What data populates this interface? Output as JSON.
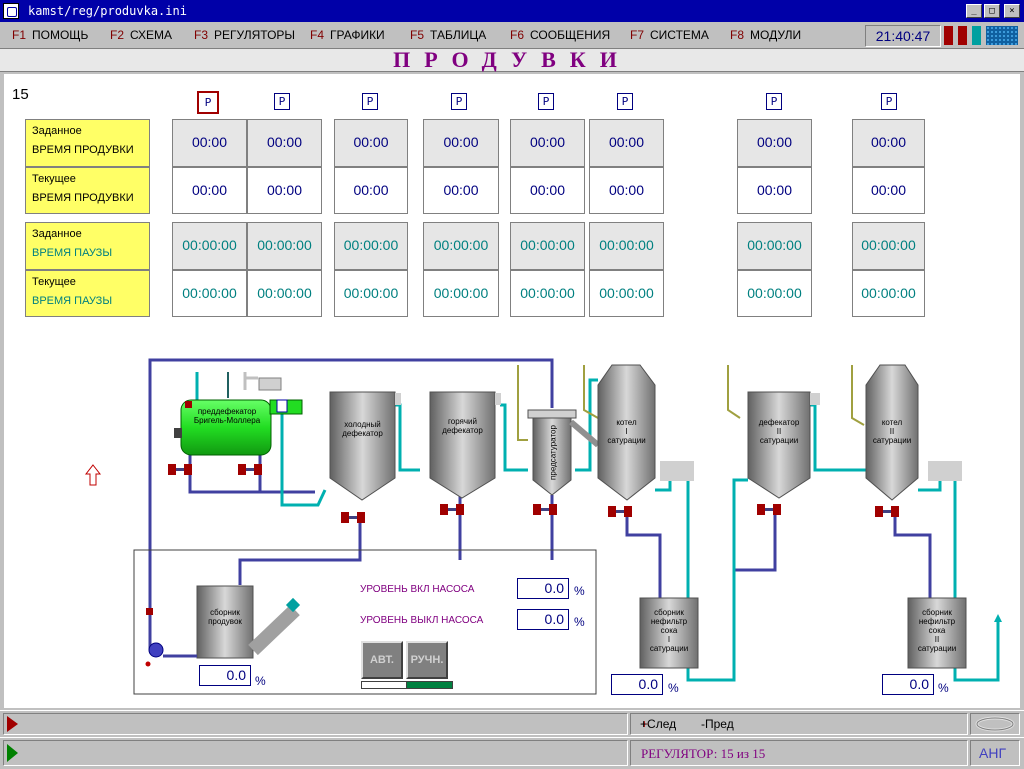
{
  "window": {
    "title": "kamst/reg/produvka.ini"
  },
  "menu": [
    {
      "key": "F1",
      "label": "ПОМОЩЬ"
    },
    {
      "key": "F2",
      "label": "СХЕМА"
    },
    {
      "key": "F3",
      "label": "РЕГУЛЯТОРЫ"
    },
    {
      "key": "F4",
      "label": "ГРАФИКИ"
    },
    {
      "key": "F5",
      "label": "ТАБЛИЦА"
    },
    {
      "key": "F6",
      "label": "СООБЩЕНИЯ"
    },
    {
      "key": "F7",
      "label": "СИСТЕМА"
    },
    {
      "key": "F8",
      "label": "МОДУЛИ"
    }
  ],
  "clock": "21:40:47",
  "header": {
    "title": "ПРОДУВКИ"
  },
  "regulator_number": "15",
  "p_button_label": "P",
  "table": {
    "labels": {
      "set_time_a": "Заданное",
      "set_time_b": "ВРЕМЯ ПРОДУВКИ",
      "cur_time_a": "Текущее",
      "cur_time_b": "ВРЕМЯ ПРОДУВКИ",
      "set_pause_a": "Заданное",
      "set_pause_b": "ВРЕМЯ ПАУЗЫ",
      "cur_pause_a": "Текущее",
      "cur_pause_b": "ВРЕМЯ ПАУЗЫ"
    },
    "blow_set": [
      "00:00",
      "00:00",
      "00:00",
      "00:00",
      "00:00",
      "00:00",
      "00:00",
      "00:00"
    ],
    "blow_cur": [
      "00:00",
      "00:00",
      "00:00",
      "00:00",
      "00:00",
      "00:00",
      "00:00",
      "00:00"
    ],
    "pause_set": [
      "00:00:00",
      "00:00:00",
      "00:00:00",
      "00:00:00",
      "00:00:00",
      "00:00:00",
      "00:00:00",
      "00:00:00"
    ],
    "pause_cur": [
      "00:00:00",
      "00:00:00",
      "00:00:00",
      "00:00:00",
      "00:00:00",
      "00:00:00",
      "00:00:00",
      "00:00:00"
    ]
  },
  "vessels": {
    "predefecator": "преддефекатор\nБригель-Моллера",
    "cold": "холодный\nдефекатор",
    "hot": "горячий\nдефекатор",
    "presaturator": "предсатуратор",
    "boiler1": "котел\nI\nсатурации",
    "defecator2": "дефекатор\nII\nсатурации",
    "boiler2": "котел\nII\nсатурации",
    "collector": "сборник\nпродувок",
    "tank1": "сборник\nнефильтр\nсока\nI\nсатурации",
    "tank2": "сборник\nнефильтр\nсока\nII\nсатурации"
  },
  "levels": {
    "on_label": "УРОВЕНЬ ВКЛ   НАСОСА",
    "off_label": "УРОВЕНЬ ВЫКЛ  НАСОСА",
    "on_value": "0.0",
    "off_value": "0.0",
    "collector_value": "0.0",
    "tank1_value": "0.0",
    "tank2_value": "0.0",
    "unit": "%"
  },
  "modes": {
    "auto": "АВТ.",
    "manual": "РУЧН."
  },
  "status": {
    "next": "+След",
    "prev": "-Пред",
    "regulator": "РЕГУЛЯТОР:  15  из  15",
    "lang": "АНГ"
  },
  "colors": {
    "accent": "#800080",
    "pipe_blue": "#4040a0",
    "pipe_teal": "#00b0b0",
    "pipe_olive": "#a0a040",
    "green_vessel": "#22dd22",
    "label_bg": "#ffff66"
  }
}
